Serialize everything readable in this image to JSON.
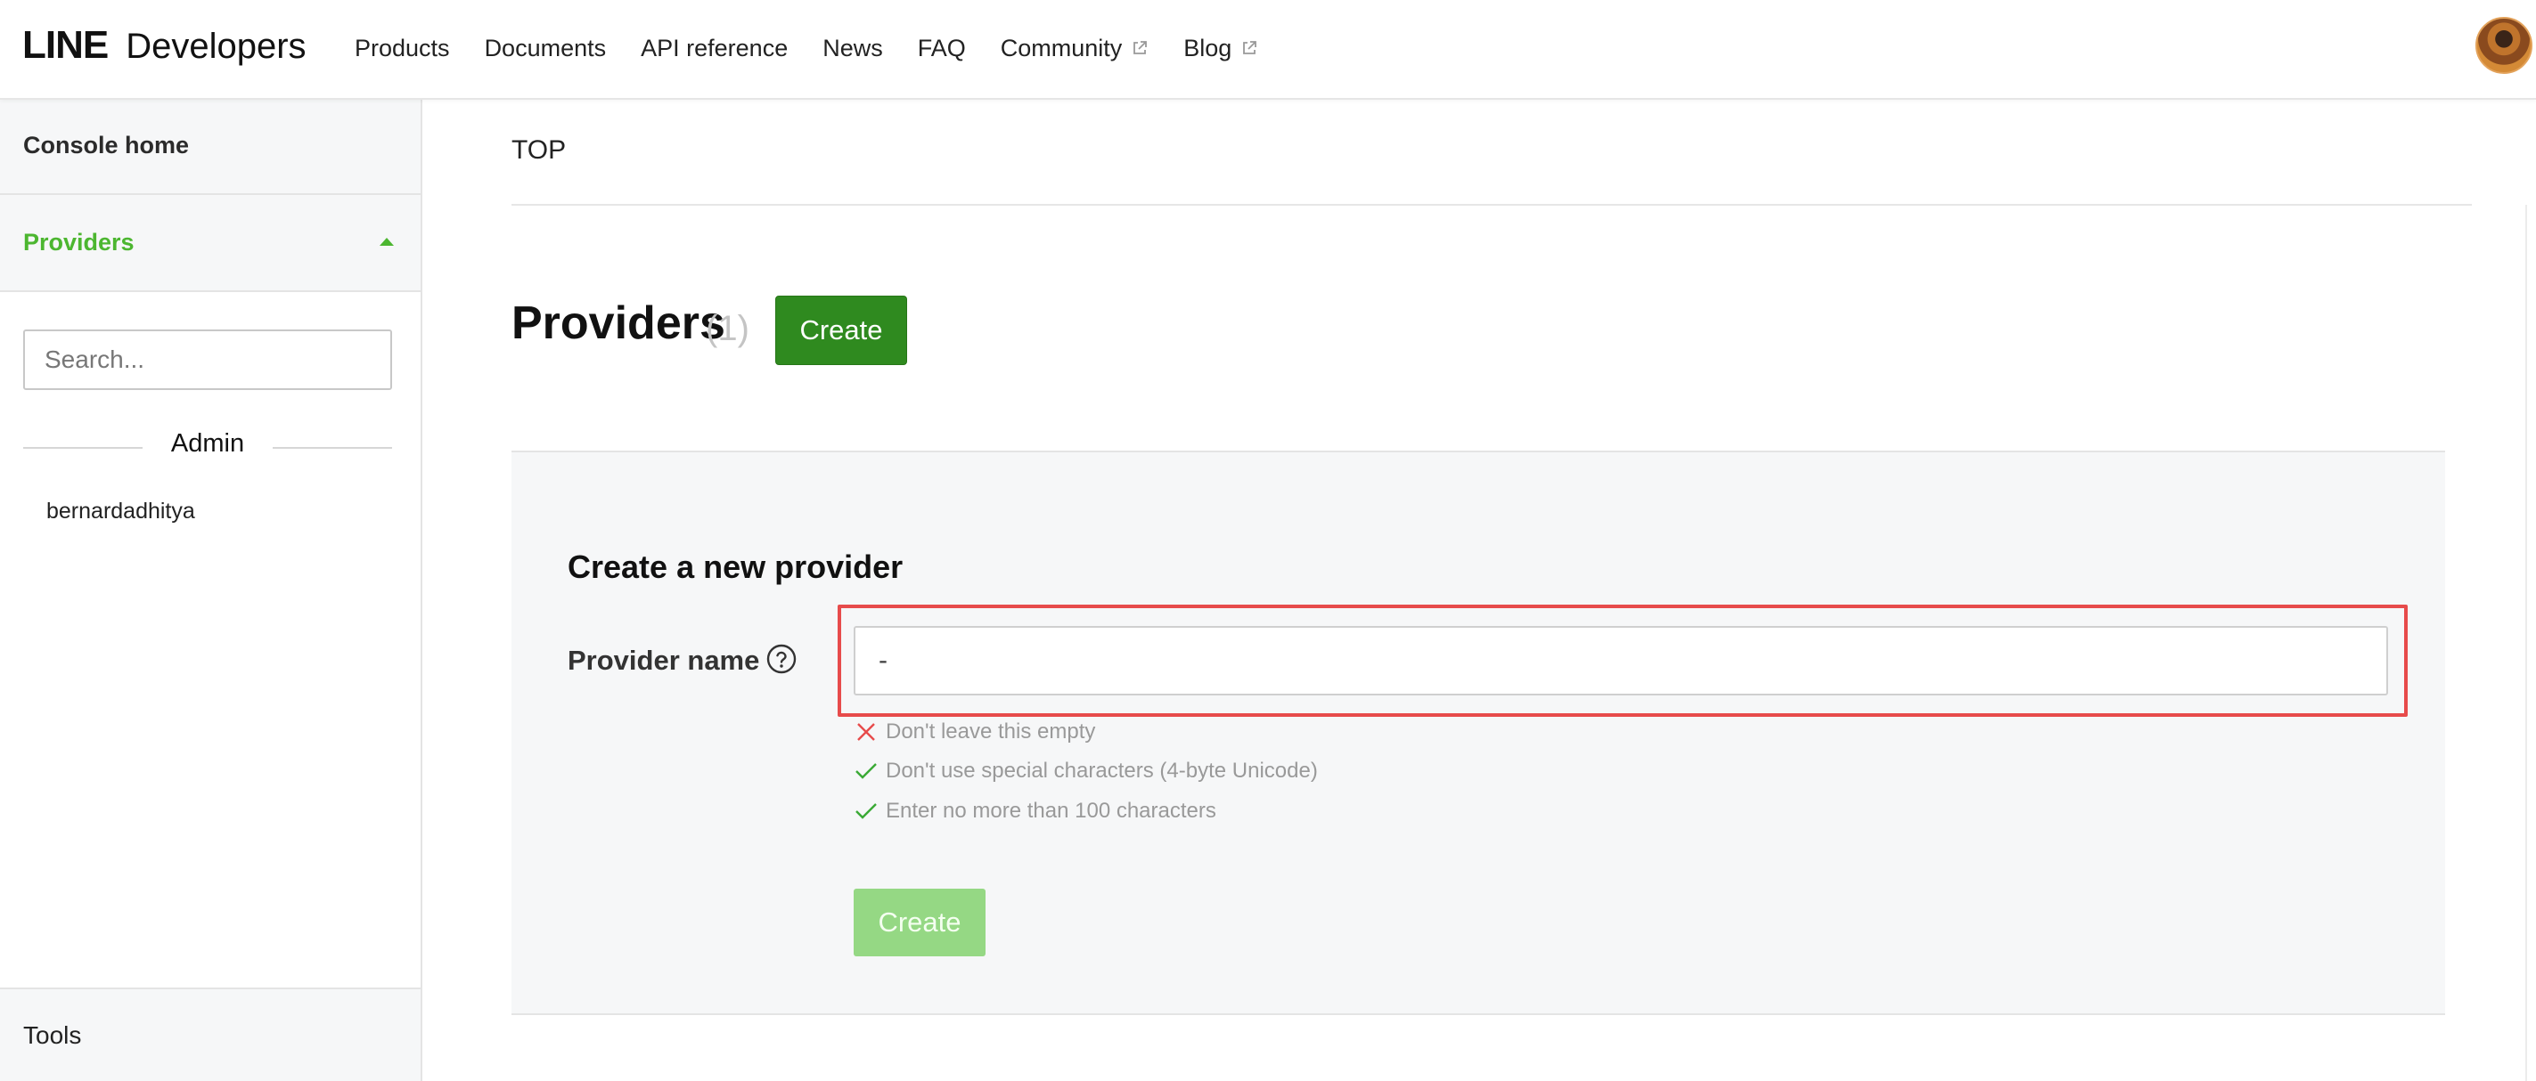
{
  "header": {
    "logo_line": "LINE",
    "logo_developers": "Developers",
    "nav": [
      {
        "label": "Products",
        "external": false
      },
      {
        "label": "Documents",
        "external": false
      },
      {
        "label": "API reference",
        "external": false
      },
      {
        "label": "News",
        "external": false
      },
      {
        "label": "FAQ",
        "external": false
      },
      {
        "label": "Community",
        "external": true,
        "icon": "external-link-icon"
      },
      {
        "label": "Blog",
        "external": true,
        "icon": "external-link-icon"
      }
    ]
  },
  "sidebar": {
    "console_home": "Console home",
    "providers_label": "Providers",
    "providers_expanded": true,
    "search_placeholder": "Search...",
    "section_label": "Admin",
    "provider_items": [
      "bernardadhitya"
    ],
    "tools_label": "Tools"
  },
  "main": {
    "breadcrumb": "TOP",
    "title": "Providers",
    "count": "(1)",
    "create_button": "Create",
    "form": {
      "title": "Create a new provider",
      "field_label": "Provider name",
      "field_value": "-",
      "rules": [
        {
          "text": "Don't leave this empty",
          "status": "fail",
          "icon": "x-icon"
        },
        {
          "text": "Don't use special characters (4-byte Unicode)",
          "status": "pass",
          "icon": "check-icon"
        },
        {
          "text": "Enter no more than 100 characters",
          "status": "pass",
          "icon": "check-icon"
        }
      ],
      "submit_button": "Create",
      "submit_enabled": false
    }
  },
  "colors": {
    "brand_green": "#4cb630",
    "button_green": "#2f8a1f",
    "button_disabled": "#95d884",
    "error_red": "#e74b4b",
    "panel_bg": "#f6f7f8"
  }
}
